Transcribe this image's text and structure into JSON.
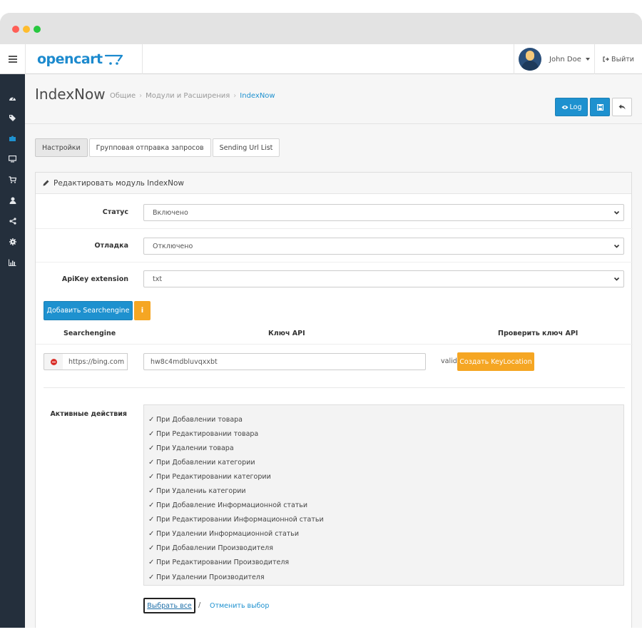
{
  "header": {
    "logo": "opencart",
    "user_name": "John Doe",
    "logout_label": "Выйти"
  },
  "page": {
    "title": "IndexNow",
    "breadcrumb": [
      "Общие",
      "Модули и Расширения",
      "IndexNow"
    ],
    "log_button": "Log"
  },
  "tabs": [
    "Настройки",
    "Групповая отправка запросов",
    "Sending Url List"
  ],
  "panel": {
    "heading": "Редактировать модуль IndexNow"
  },
  "form": {
    "status": {
      "label": "Статус",
      "value": "Включено"
    },
    "debug": {
      "label": "Отладка",
      "value": "Отключено"
    },
    "apikey_ext": {
      "label": "ApiKey extension",
      "value": "txt"
    }
  },
  "engines": {
    "add_button": "Добавить Searchengine",
    "info_button": "i",
    "columns": [
      "Searchengine",
      "Ключ API",
      "Проверить ключ API"
    ],
    "rows": [
      {
        "url": "https://bing.com",
        "key": "hw8c4mdbluvqxxbt",
        "status": "valid",
        "action": "Создать KeyLocation"
      }
    ]
  },
  "actions": {
    "label": "Активные действия",
    "items": [
      "При Добавлении товара",
      "При Редактировании товара",
      "При Удалении товара",
      "При Добавлении категории",
      "При Редактировании категории",
      "При Удалениь категории",
      "При Добавление Информационной статьи",
      "При Редактировании Информационной статьи",
      "При Удалении Информационной статьи",
      "При Добавлении Производителя",
      "При Редактировании Производителя",
      "При Удалении Производителя"
    ],
    "select_all": "Выбрать все",
    "separator": "/",
    "deselect": "Отменить выбор"
  },
  "colors": {
    "primary": "#1e91cf",
    "warning": "#f5a623",
    "sidebar": "#242f3c",
    "danger": "#d9312b"
  },
  "icons": {
    "sidebar": [
      "dashboard-icon",
      "tag-icon",
      "puzzle-icon",
      "desktop-icon",
      "cart-icon",
      "user-icon",
      "share-icon",
      "gear-icon",
      "bar-chart-icon"
    ]
  }
}
